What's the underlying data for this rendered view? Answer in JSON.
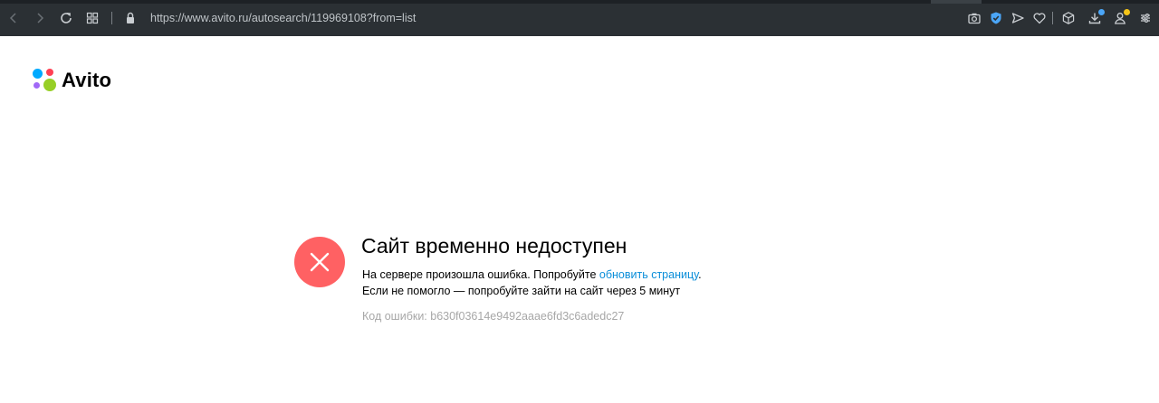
{
  "browser": {
    "url": "https://www.avito.ru/autosearch/119969108?from=list",
    "icons": [
      "back-icon",
      "forward-icon",
      "reload-icon",
      "speed-dial-icon",
      "lock-icon",
      "camera-icon",
      "shield-icon",
      "send-icon",
      "heart-icon",
      "box-icon",
      "download-icon",
      "profile-icon",
      "easy-setup-icon"
    ],
    "colors": {
      "toolbar": "#2b3034",
      "shield": "#4ba6f7",
      "badge_blue": "#4ba6f7",
      "badge_yellow": "#f5c518"
    }
  },
  "logo": {
    "text": "Avito",
    "dot_colors": [
      "#00aaff",
      "#ff4053",
      "#97cf26",
      "#a169f7"
    ]
  },
  "error": {
    "title": "Сайт временно недоступен",
    "line1_prefix": "На сервере произошла ошибка. Попробуйте ",
    "line1_link": "обновить страницу",
    "line1_suffix": ".",
    "line2": "Если не помогло — попробуйте зайти на сайт через 5 минут",
    "code_label": "Код ошибки: b630f03614e9492aaae6fd3c6adedc27",
    "circle_color": "#ff6163",
    "link_color": "#0a8ed9"
  }
}
